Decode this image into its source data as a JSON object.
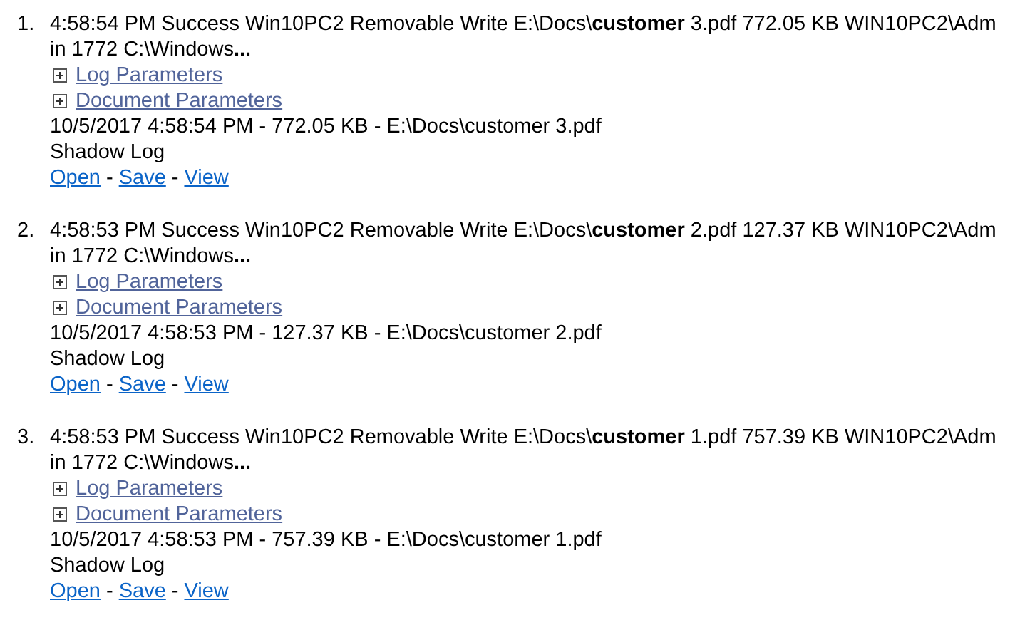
{
  "results": [
    {
      "number": "1.",
      "summary_line_1": "4:58:54 PM Success Win10PC2 Removable Write E:\\Docs\\**customer** 3.pdf 772.05 KB WIN10PC2\\Adm",
      "summary_line_2": "in 1772 C:\\Windows**...**",
      "sections": [
        {
          "label": "Log Parameters",
          "expanded": false
        },
        {
          "label": "Document Parameters",
          "expanded": false
        }
      ],
      "details": "10/5/2017 4:58:54 PM - 772.05 KB - E:\\Docs\\customer 3.pdf",
      "log_type": "Shadow Log",
      "actions": [
        {
          "kind": "link",
          "text": "Open"
        },
        {
          "kind": "separator",
          "text": "-"
        },
        {
          "kind": "link",
          "text": "Save"
        },
        {
          "kind": "separator",
          "text": "-"
        },
        {
          "kind": "link",
          "text": "View"
        }
      ]
    },
    {
      "number": "2.",
      "summary_line_1": "4:58:53 PM Success Win10PC2 Removable Write E:\\Docs\\**customer** 2.pdf 127.37 KB WIN10PC2\\Adm",
      "summary_line_2": "in 1772 C:\\Windows**...**",
      "sections": [
        {
          "label": "Log Parameters",
          "expanded": false
        },
        {
          "label": "Document Parameters",
          "expanded": false
        }
      ],
      "details": "10/5/2017 4:58:53 PM - 127.37 KB - E:\\Docs\\customer 2.pdf",
      "log_type": "Shadow Log",
      "actions": [
        {
          "kind": "link",
          "text": "Open"
        },
        {
          "kind": "separator",
          "text": "-"
        },
        {
          "kind": "link",
          "text": "Save"
        },
        {
          "kind": "separator",
          "text": "-"
        },
        {
          "kind": "link",
          "text": "View"
        }
      ]
    },
    {
      "number": "3.",
      "summary_line_1": "4:58:53 PM Success Win10PC2 Removable Write E:\\Docs\\**customer** 1.pdf 757.39 KB WIN10PC2\\Adm",
      "summary_line_2": "in 1772 C:\\Windows**...**",
      "sections": [
        {
          "label": "Log Parameters",
          "expanded": false
        },
        {
          "label": "Document Parameters",
          "expanded": false
        }
      ],
      "details": "10/5/2017 4:58:53 PM - 757.39 KB - E:\\Docs\\customer 1.pdf",
      "log_type": "Shadow Log",
      "actions": [
        {
          "kind": "link",
          "text": "Open"
        },
        {
          "kind": "separator",
          "text": "-"
        },
        {
          "kind": "link",
          "text": "Save"
        },
        {
          "kind": "separator",
          "text": "-"
        },
        {
          "kind": "link",
          "text": "View"
        }
      ]
    }
  ]
}
